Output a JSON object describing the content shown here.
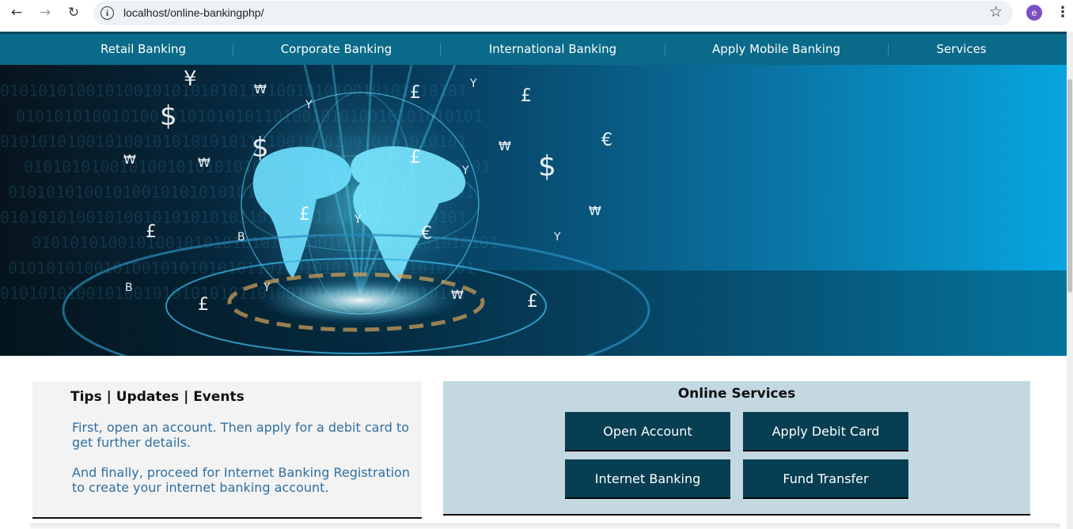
{
  "browser": {
    "url": "localhost/online-bankingphp/",
    "profile_initial": "e",
    "icons": [
      "back-arrow-icon",
      "forward-arrow-icon",
      "reload-icon",
      "info-icon",
      "star-icon",
      "kebab-menu-icon"
    ]
  },
  "nav": {
    "items": [
      {
        "label": "Retail Banking"
      },
      {
        "label": "Corporate Banking"
      },
      {
        "label": "International Banking"
      },
      {
        "label": "Apply Mobile Banking"
      },
      {
        "label": "Services"
      }
    ]
  },
  "banner": {
    "symbols": [
      "¥",
      "₩",
      "$",
      "£",
      "Y",
      "€",
      "B"
    ],
    "binary_text": "0101010100101001010101010110100101010010101010101"
  },
  "tips": {
    "title": "Tips | Updates | Events",
    "paragraph1": "First, open an account. Then apply for a debit card to get further details.",
    "paragraph2": "And finally, proceed for Internet Banking Registration to create your internet banking account."
  },
  "services": {
    "title": "Online Services",
    "buttons": [
      {
        "label": "Open Account"
      },
      {
        "label": "Apply Debit Card"
      },
      {
        "label": "Internet Banking"
      },
      {
        "label": "Fund Transfer"
      }
    ]
  },
  "colors": {
    "nav_bg": "#0a6a8a",
    "button_bg": "#073e52",
    "services_bg": "#c4d8e2",
    "tips_text": "#2f6fa0"
  }
}
